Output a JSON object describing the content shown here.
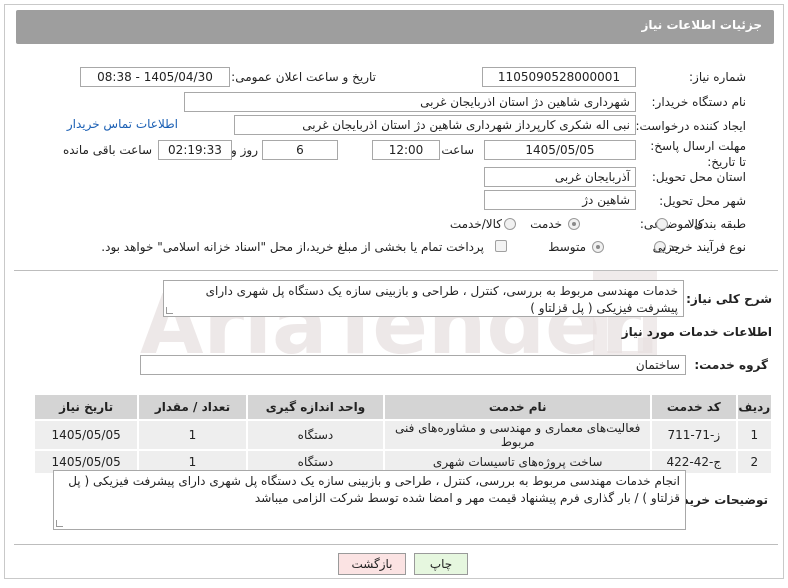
{
  "header": {
    "title": "جزئیات اطلاعات نیاز"
  },
  "labels": {
    "need_number": "شماره نیاز:",
    "announce_datetime": "تاریخ و ساعت اعلان عمومی:",
    "buyer_org": "نام دستگاه خریدار:",
    "requester": "ایجاد کننده درخواست:",
    "contact_link": "اطلاعات تماس خریدار",
    "deadline": "مهلت ارسال پاسخ: تا تاریخ:",
    "time_word": "ساعت",
    "day_and": "روز و",
    "remaining": "ساعت باقی مانده",
    "province": "استان محل تحویل:",
    "city": "شهر محل تحویل:",
    "category": "طبقه بندی موضوعی:",
    "purchase_type": "نوع فرآیند خرید :",
    "general_desc": "شرح کلی نیاز:",
    "services_info": "اطلاعات خدمات مورد نیاز",
    "service_group": "گروه خدمت:",
    "buyer_notes": "توضیحات خریدار:"
  },
  "values": {
    "need_number": "1105090528000001",
    "announce_datetime": "1405/04/30 - 08:38",
    "buyer_org": "شهرداری شاهین دژ استان اذربایجان غربی",
    "requester": "نبی اله شکری کارپرداز شهرداری شاهین دژ استان اذربایجان غربی",
    "deadline_date": "1405/05/05",
    "deadline_time": "12:00",
    "days": "6",
    "remaining_time": "02:19:33",
    "province": "آذربایجان غربی",
    "city": "شاهین دژ",
    "general_desc": "خدمات مهندسی مربوط به بررسی، کنترل ، طراحی و بازبینی سازه یک دستگاه پل شهری دارای پیشرفت فیزیکی  ( پل قزلتاو )",
    "service_group": "ساختمان",
    "buyer_notes": "انجام خدمات مهندسی مربوط به بررسی، کنترل ، طراحی و بازبینی سازه یک دستگاه پل شهری دارای پیشرفت فیزیکی  ( پل قزلتاو ) / بار گذاری فرم پیشنهاد قیمت مهر و امضا شده توسط شرکت الزامی میباشد"
  },
  "category_options": [
    {
      "label": "کالا",
      "checked": false
    },
    {
      "label": "خدمت",
      "checked": true
    },
    {
      "label": "کالا/خدمت",
      "checked": false
    }
  ],
  "purchase_options": [
    {
      "label": "جزیی",
      "checked": false
    },
    {
      "label": "متوسط",
      "checked": true
    }
  ],
  "treasury_note": "پرداخت تمام یا بخشی از مبلغ خرید،از محل \"اسناد خزانه اسلامی\" خواهد بود.",
  "table": {
    "headers": [
      "ردیف",
      "کد خدمت",
      "نام خدمت",
      "واحد اندازه گیری",
      "تعداد / مقدار",
      "تاریخ نیاز"
    ],
    "rows": [
      [
        "1",
        "ز-71-711",
        "فعالیت‌های معماری و مهندسی و مشاوره‌های فنی مربوط",
        "دستگاه",
        "1",
        "1405/05/05"
      ],
      [
        "2",
        "ج-42-422",
        "ساخت پروژه‌های تاسیسات شهری",
        "دستگاه",
        "1",
        "1405/05/05"
      ]
    ]
  },
  "buttons": {
    "back": "بازگشت",
    "print": "چاپ"
  },
  "watermark": "AriaTender.net",
  "colors": {
    "header_bg": "#9e9e9e",
    "link": "#1a5fb4",
    "back_button_bg": "#fbe3e3",
    "print_button_bg": "#e6f7df"
  }
}
